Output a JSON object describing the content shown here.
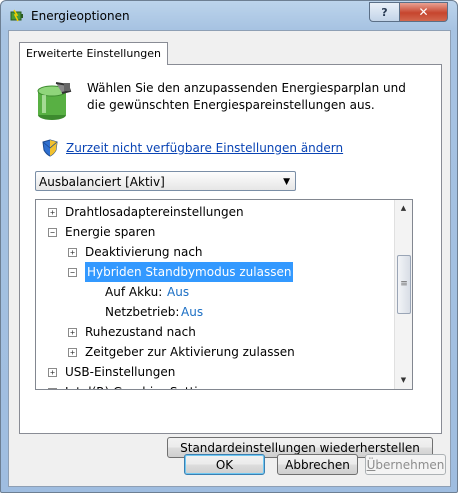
{
  "window": {
    "title": "Energieoptionen",
    "help_label": "?",
    "close_label": "✕"
  },
  "tab": {
    "label": "Erweiterte Einstellungen"
  },
  "intro": {
    "description": "Wählen Sie den anzupassenden Energiesparplan und die gewünschten Energiespareinstellungen aus.",
    "settings_link": "Zurzeit nicht verfügbare Einstellungen ändern"
  },
  "plan_select": {
    "value": "Ausbalanciert [Aktiv]",
    "arrow": "▼"
  },
  "tree": {
    "items": [
      {
        "expander": "+",
        "label": "Drahtlosadaptereinstellungen"
      },
      {
        "expander": "−",
        "label": "Energie sparen"
      },
      {
        "expander": "+",
        "label": "Deaktivierung nach"
      },
      {
        "expander": "−",
        "label": "Hybriden Standbymodus zulassen"
      },
      {
        "label": "Auf Akku:",
        "value": "Aus"
      },
      {
        "label": "Netzbetrieb:",
        "value": "Aus"
      },
      {
        "expander": "+",
        "label": "Ruhezustand nach"
      },
      {
        "expander": "+",
        "label": "Zeitgeber zur Aktivierung zulassen"
      },
      {
        "expander": "+",
        "label": "USB-Einstellungen"
      },
      {
        "expander": "+",
        "label": "Intel(R) Graphics Settings"
      }
    ],
    "scroll_up": "▲",
    "scroll_down": "▼",
    "scroll_grip": "≡"
  },
  "buttons": {
    "restore": "Standardeinstellungen wiederherstellen",
    "ok": "OK",
    "cancel": "Abbrechen",
    "apply_pre": "Ü",
    "apply_rest": "bernehmen"
  },
  "colors": {
    "selection": "#3399ff",
    "link": "#0a44b4",
    "close_button": "#c6452e"
  }
}
